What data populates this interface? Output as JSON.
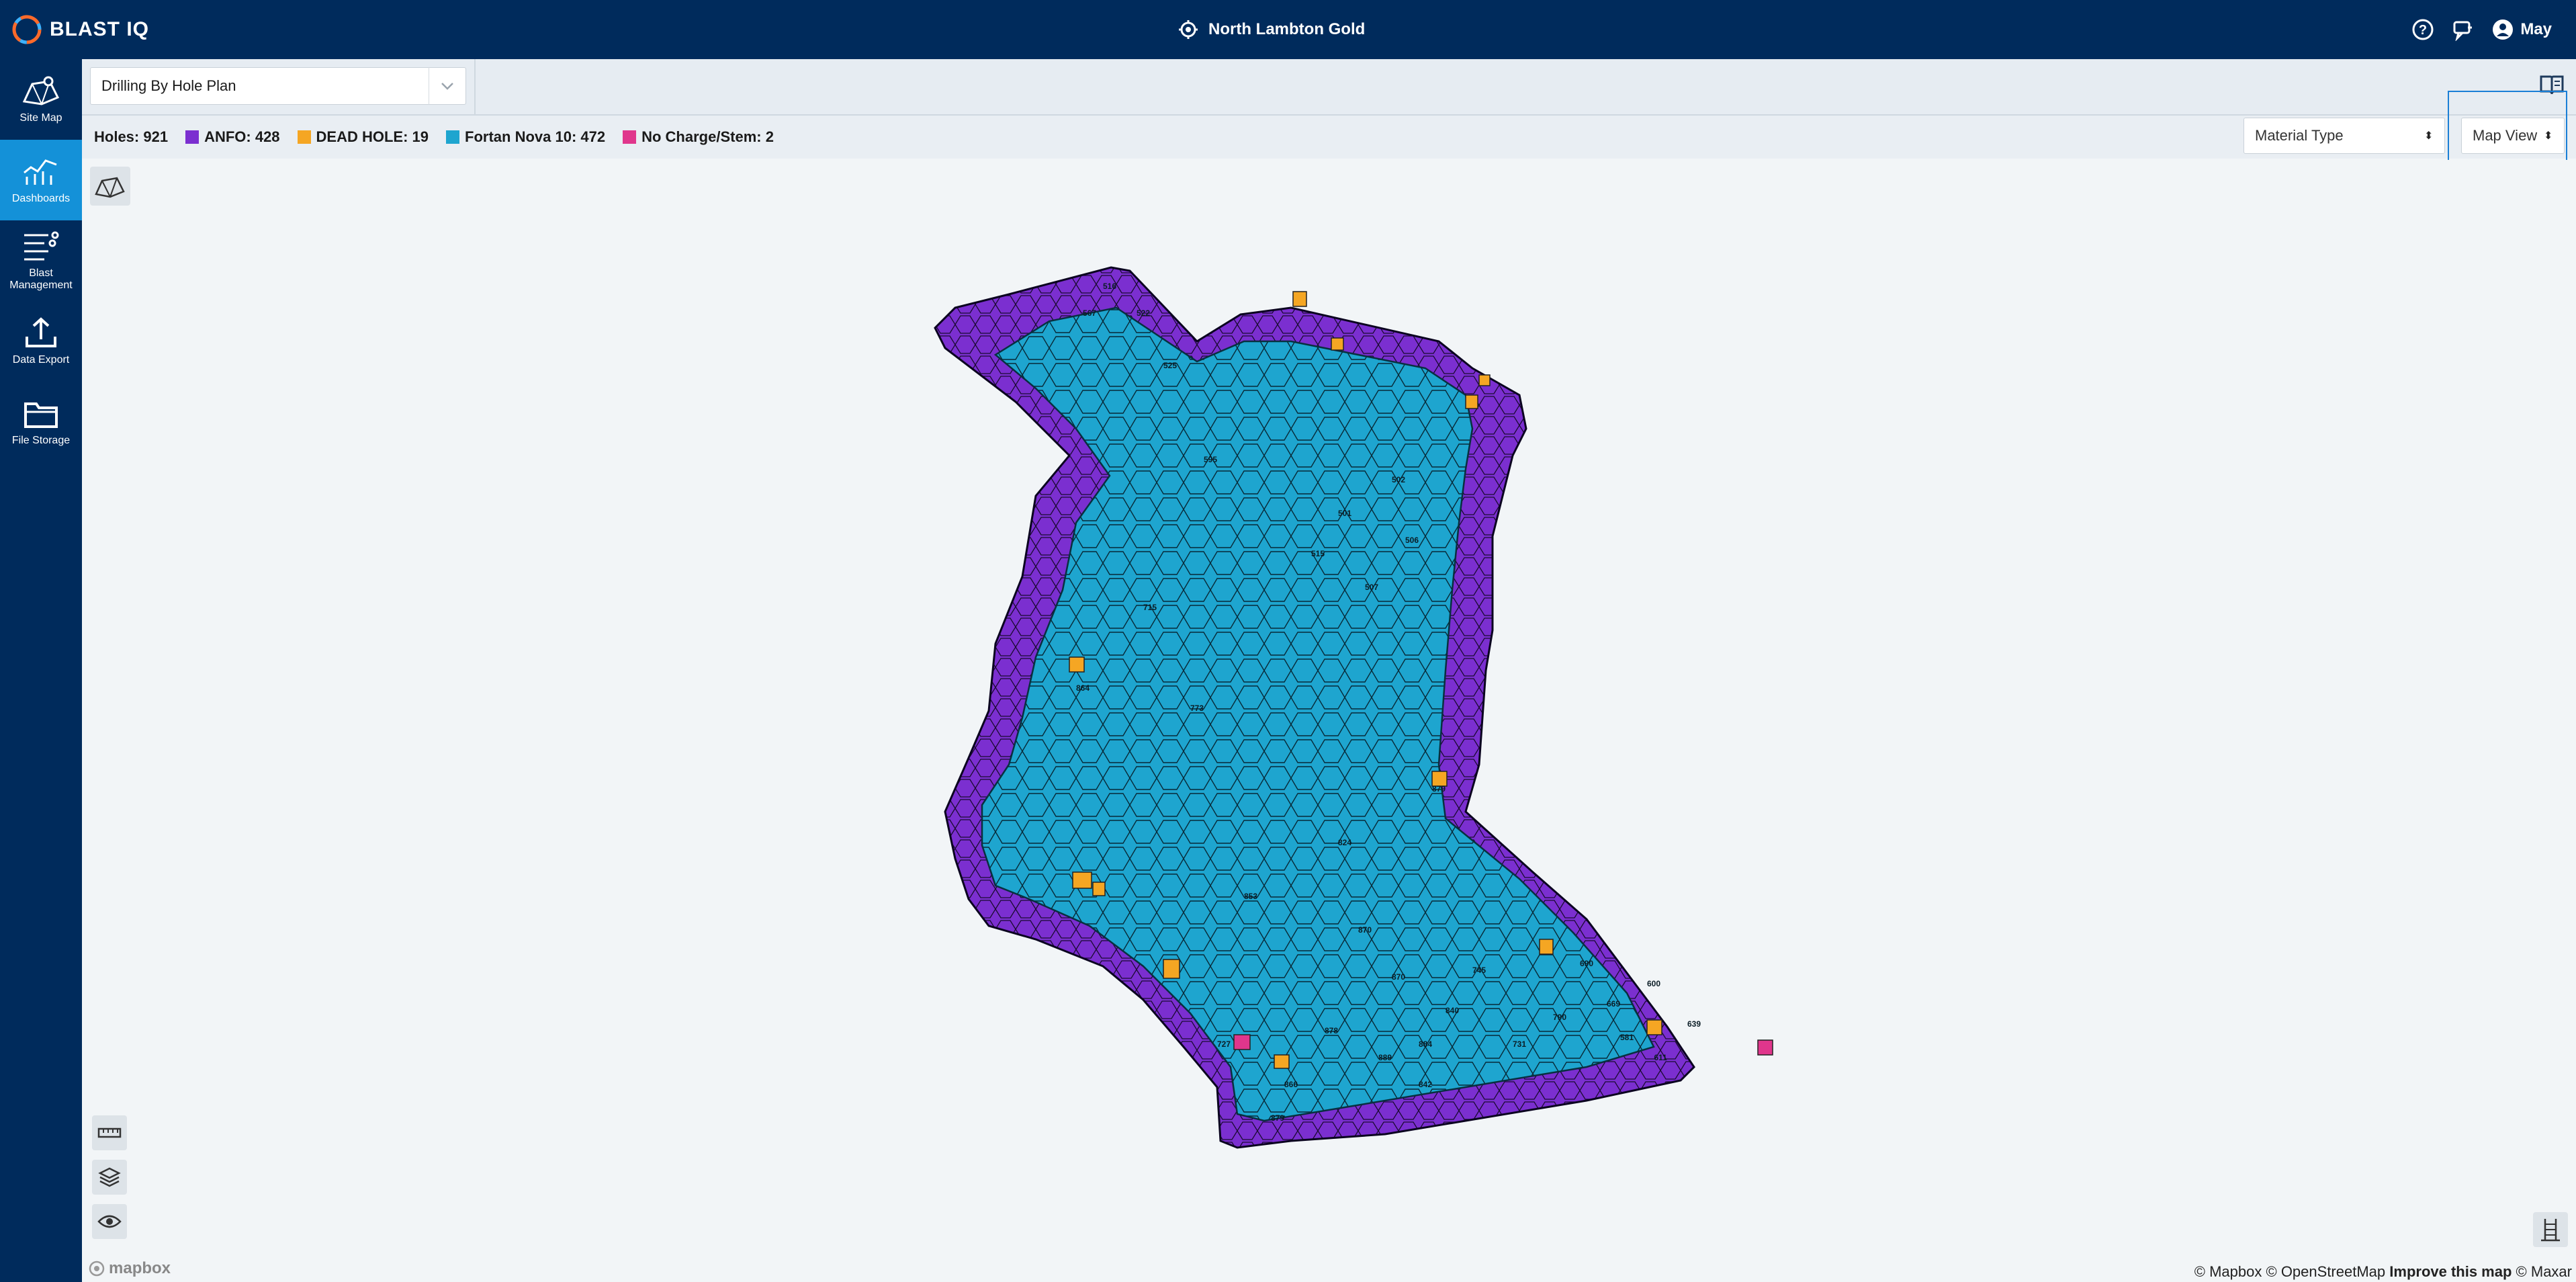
{
  "app": {
    "logo": "BLAST IQ",
    "site": "North Lambton Gold",
    "user": "May"
  },
  "sidebar": {
    "items": [
      {
        "label": "Site Map",
        "icon": "site-map-icon"
      },
      {
        "label": "Dashboards",
        "icon": "dashboards-icon",
        "active": true
      },
      {
        "label": "Blast Management",
        "icon": "blast-management-icon"
      },
      {
        "label": "Data Export",
        "icon": "data-export-icon"
      },
      {
        "label": "File Storage",
        "icon": "file-storage-icon"
      }
    ]
  },
  "toolbar": {
    "plan_select": "Drilling By Hole Plan"
  },
  "legend": {
    "holes": "Holes: 921",
    "entries": [
      {
        "label": "ANFO: 428",
        "color": "#7B2FD0"
      },
      {
        "label": "DEAD HOLE: 19",
        "color": "#F5A623"
      },
      {
        "label": "Fortan Nova 10: 472",
        "color": "#1EA5CF"
      },
      {
        "label": "No Charge/Stem: 2",
        "color": "#E0368C"
      }
    ]
  },
  "controls": {
    "color_by": "Material Type",
    "view_mode": "Map View"
  },
  "map": {
    "attribution": {
      "mapbox": "© Mapbox",
      "osm": "© OpenStreetMap",
      "improve": "Improve this map",
      "maxar": "© Maxar"
    },
    "mapbox_logo": "mapbox",
    "sample_hole_labels": [
      "516",
      "567",
      "522",
      "525",
      "595",
      "501",
      "502",
      "506",
      "515",
      "507",
      "727",
      "864",
      "840",
      "773",
      "853",
      "866",
      "842",
      "878",
      "889",
      "715",
      "731",
      "745",
      "790",
      "870",
      "824",
      "870",
      "884",
      "879",
      "879",
      "690",
      "669",
      "600",
      "581",
      "611",
      "639"
    ]
  },
  "colors": {
    "navy": "#002B5C",
    "accent": "#1491d8",
    "anfo": "#7B2FD0",
    "dead": "#F5A623",
    "fortan": "#1EA5CF",
    "stem": "#E0368C"
  }
}
